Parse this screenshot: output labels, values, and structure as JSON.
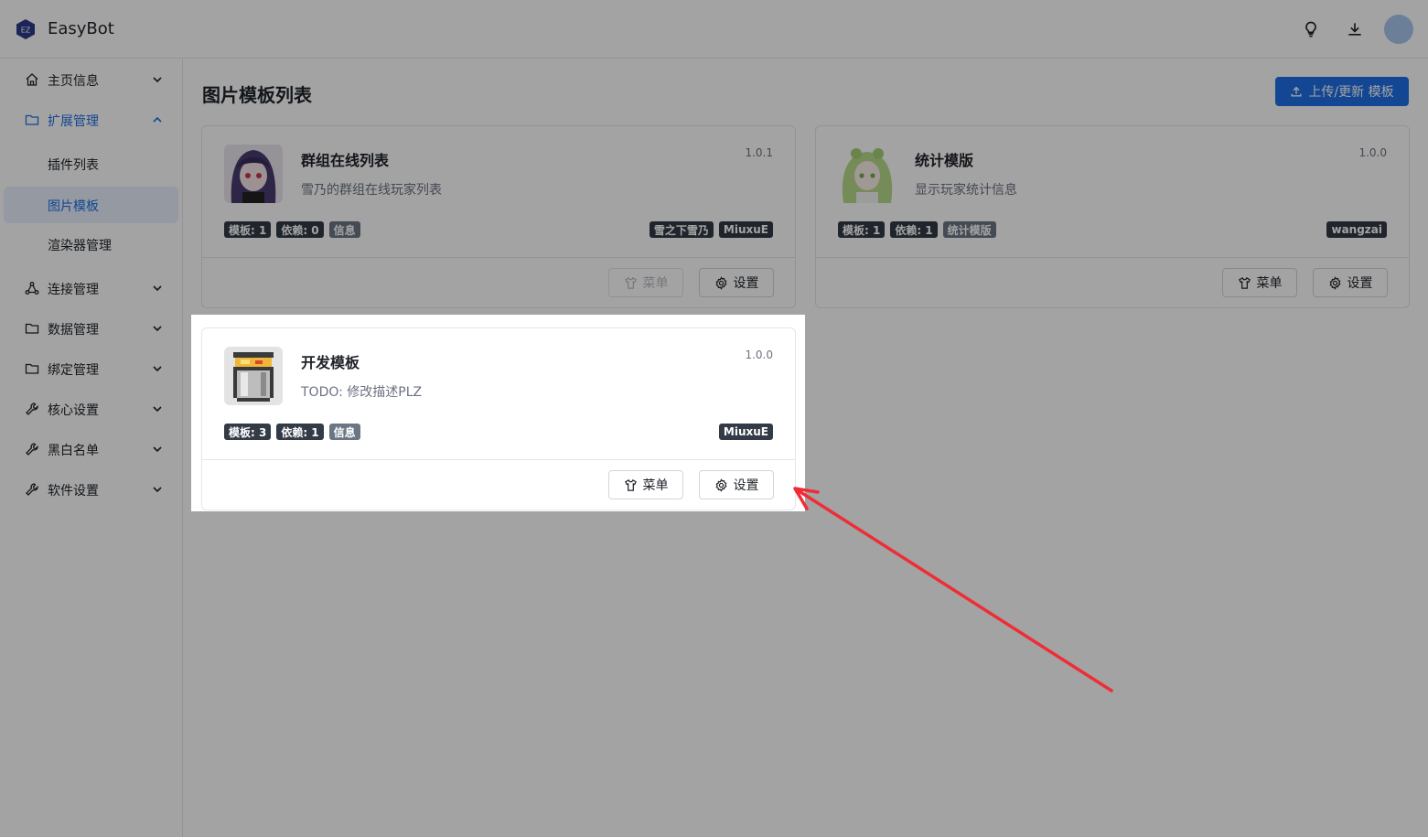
{
  "app": {
    "title": "EasyBot",
    "logo_text": "EZ"
  },
  "header": {
    "icons": [
      "lightbulb-icon",
      "download-icon",
      "avatar"
    ]
  },
  "sidebar": {
    "items": [
      {
        "label": "主页信息",
        "icon": "home-icon",
        "expanded": false
      },
      {
        "label": "扩展管理",
        "icon": "folder-icon",
        "expanded": true,
        "active": true
      },
      {
        "label": "连接管理",
        "icon": "network-icon",
        "expanded": false
      },
      {
        "label": "数据管理",
        "icon": "folder-icon",
        "expanded": false
      },
      {
        "label": "绑定管理",
        "icon": "folder-icon",
        "expanded": false
      },
      {
        "label": "核心设置",
        "icon": "wrench-icon",
        "expanded": false
      },
      {
        "label": "黑白名单",
        "icon": "wrench-icon",
        "expanded": false
      },
      {
        "label": "软件设置",
        "icon": "wrench-icon",
        "expanded": false
      }
    ],
    "sub_items": [
      {
        "label": "插件列表"
      },
      {
        "label": "图片模板",
        "selected": true
      },
      {
        "label": "渲染器管理"
      }
    ]
  },
  "main": {
    "title": "图片模板列表",
    "upload_button": "上传/更新 模板"
  },
  "cards": [
    {
      "name": "群组在线列表",
      "description": "雪乃的群组在线玩家列表",
      "version": "1.0.1",
      "tags_left": [
        "模板: 1",
        "依赖: 0",
        "信息"
      ],
      "tags_right": [
        "雪之下雪乃",
        "MiuxuE"
      ],
      "menu_label": "菜单",
      "settings_label": "设置",
      "menu_disabled": true
    },
    {
      "name": "统计模版",
      "description": "显示玩家统计信息",
      "version": "1.0.0",
      "tags_left": [
        "模板: 1",
        "依赖: 1",
        "统计模版"
      ],
      "tags_right": [
        "wangzai"
      ],
      "menu_label": "菜单",
      "settings_label": "设置",
      "menu_disabled": false
    },
    {
      "name": "开发模板",
      "description": "TODO: 修改描述PLZ",
      "version": "1.0.0",
      "tags_left": [
        "模板: 3",
        "依赖: 1",
        "信息"
      ],
      "tags_right": [
        "MiuxuE"
      ],
      "menu_label": "菜单",
      "settings_label": "设置",
      "menu_disabled": false
    }
  ],
  "colors": {
    "accent": "#1e6fe6",
    "tag_dark": "#333b47",
    "annotation_arrow": "#ee2d36"
  }
}
